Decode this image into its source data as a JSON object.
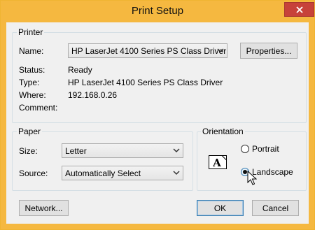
{
  "window": {
    "title": "Print Setup"
  },
  "printer": {
    "group_label": "Printer",
    "name_label": "Name:",
    "name_value": "HP LaserJet 4100 Series PS Class Driver",
    "properties_label": "Properties...",
    "status_label": "Status:",
    "status_value": "Ready",
    "type_label": "Type:",
    "type_value": "HP LaserJet 4100 Series PS Class Driver",
    "where_label": "Where:",
    "where_value": "192.168.0.26",
    "comment_label": "Comment:",
    "comment_value": ""
  },
  "paper": {
    "group_label": "Paper",
    "size_label": "Size:",
    "size_value": "Letter",
    "source_label": "Source:",
    "source_value": "Automatically Select"
  },
  "orientation": {
    "group_label": "Orientation",
    "icon_letter": "A",
    "portrait_label": "Portrait",
    "landscape_label": "Landscape",
    "selected": "Landscape"
  },
  "buttons": {
    "network_label": "Network...",
    "ok_label": "OK",
    "cancel_label": "Cancel"
  },
  "colors": {
    "title_bar": "#f5b840",
    "close_button": "#c7423a",
    "dialog_bg": "#f0f0f0",
    "default_button_border": "#3c7fb1"
  },
  "icons": {
    "close": "close-icon",
    "dropdown": "chevron-down-icon",
    "page": "page-icon",
    "cursor": "mouse-pointer-icon"
  }
}
